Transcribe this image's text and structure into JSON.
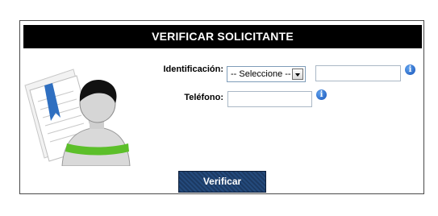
{
  "form": {
    "title": "VERIFICAR SOLICITANTE",
    "identificacion": {
      "label": "Identificación:",
      "select_value": "-- Seleccione --",
      "value": ""
    },
    "telefono": {
      "label": "Teléfono:",
      "value": ""
    },
    "submit_label": "Verificar",
    "info_icon_glyph": "i"
  },
  "icons": [
    "user-document-illustration",
    "info-icon",
    "chevron-down-icon"
  ],
  "colors": {
    "title_bar": "#000000",
    "button": "#244a7c",
    "info": "#1a5cc2",
    "accent_green": "#5cbf2a"
  }
}
